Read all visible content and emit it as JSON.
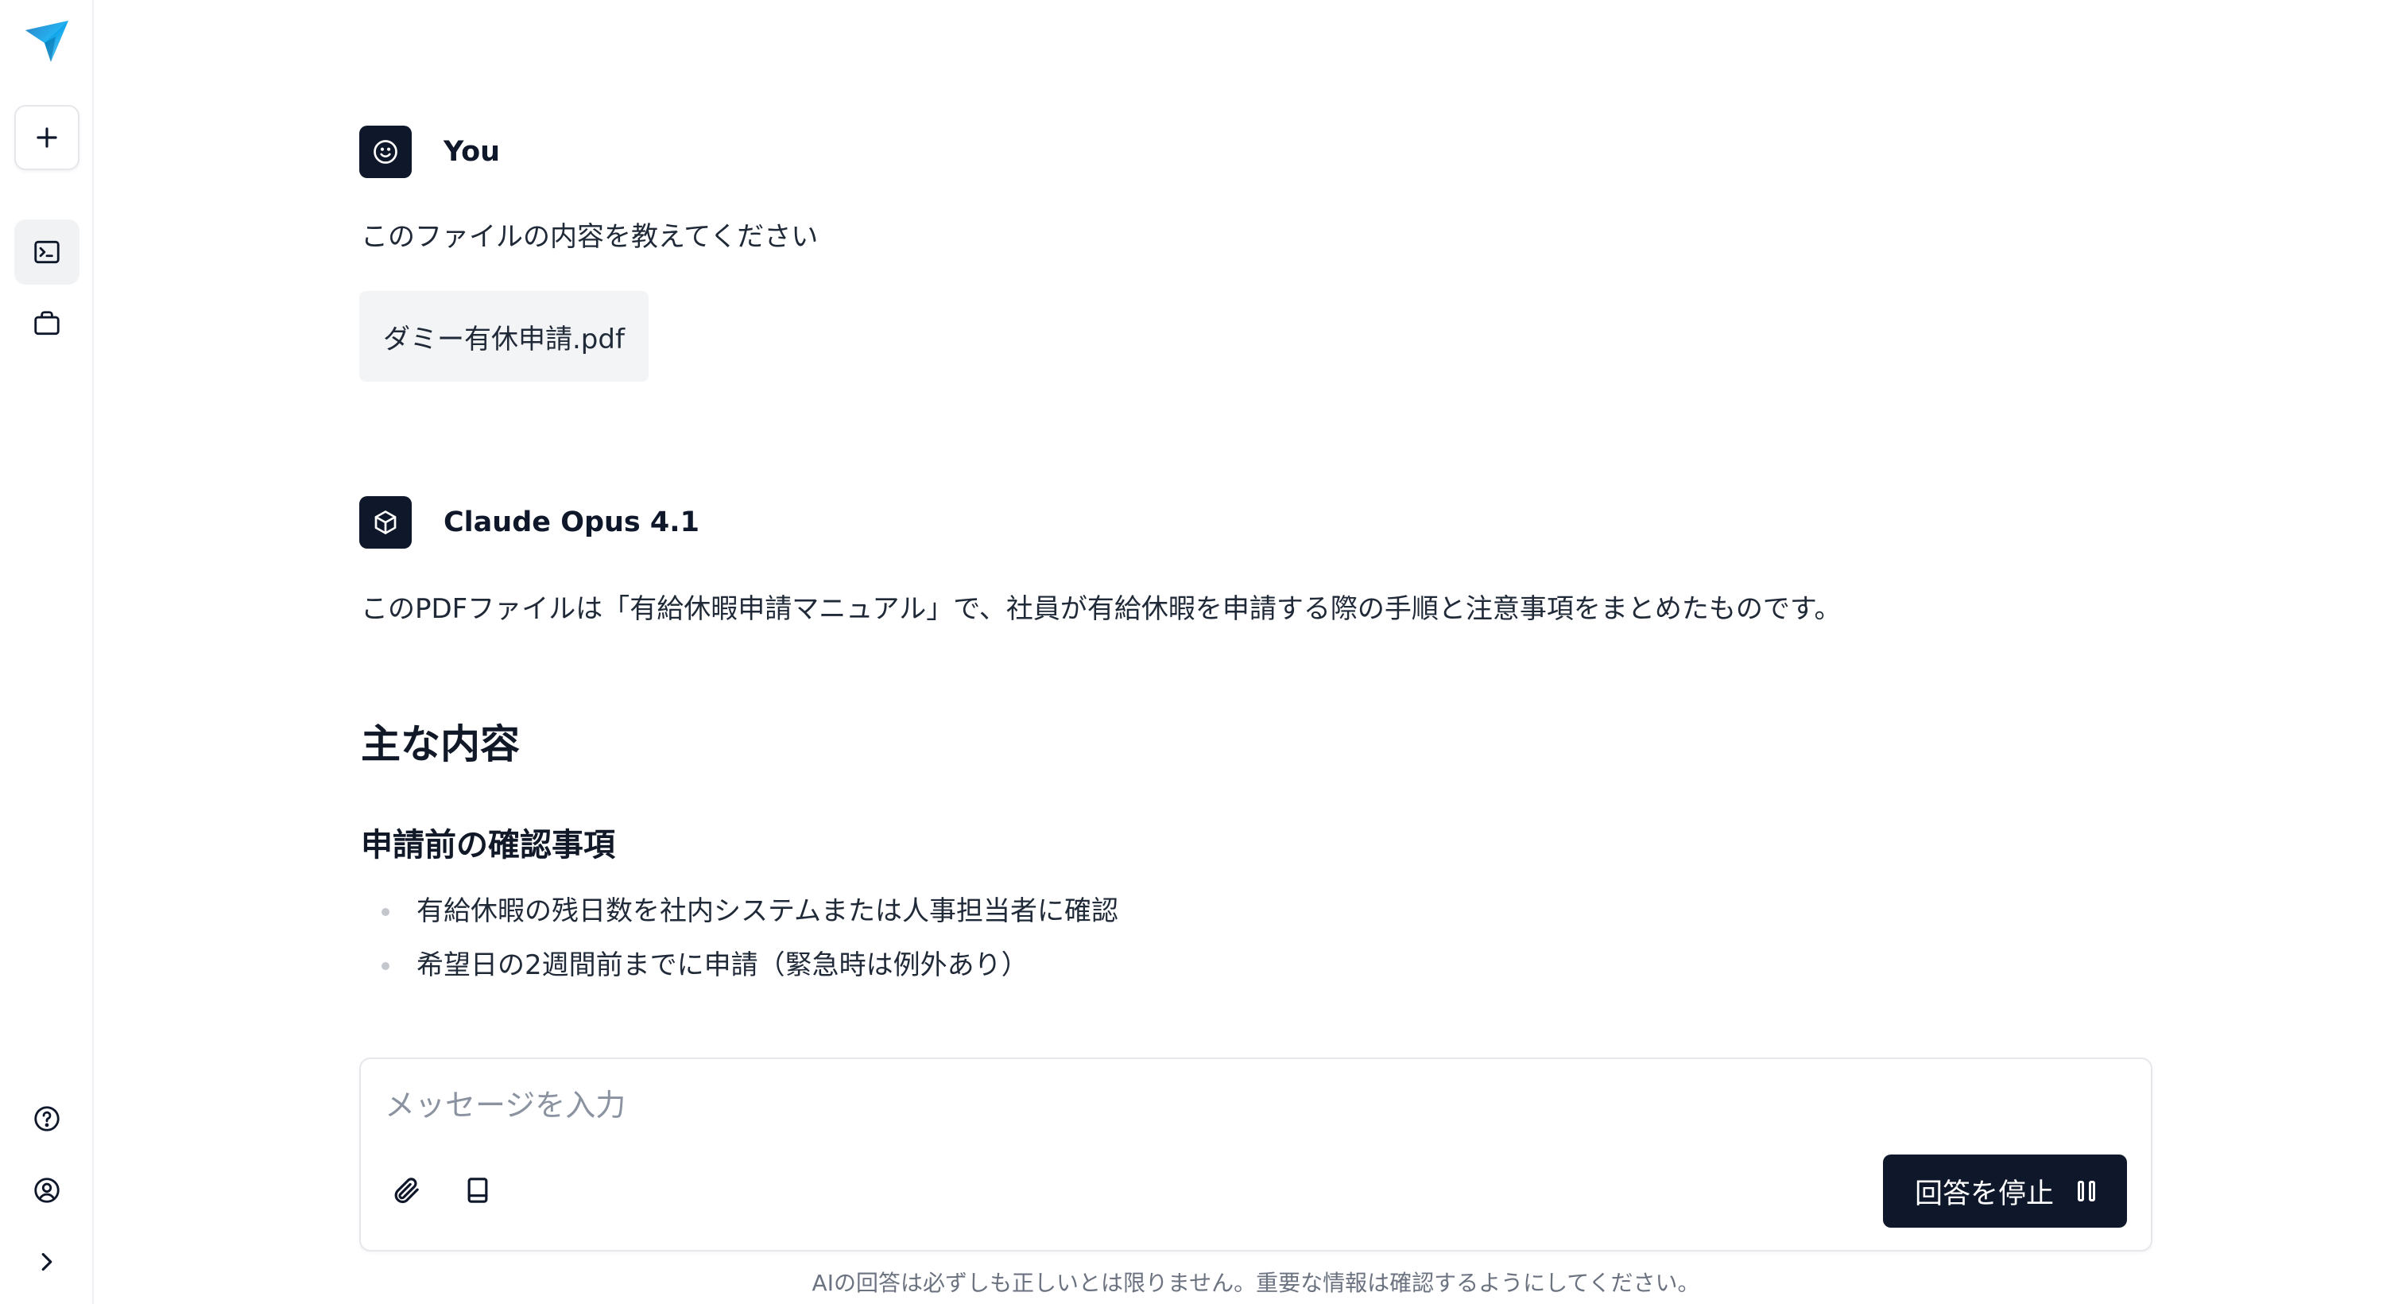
{
  "sidebar": {
    "logo_icon": "paper-plane-logo",
    "items": [
      {
        "name": "new-chat",
        "icon": "plus-icon"
      },
      {
        "name": "terminal",
        "icon": "terminal-icon",
        "active": true
      },
      {
        "name": "briefcase",
        "icon": "briefcase-icon"
      }
    ],
    "bottom_items": [
      {
        "name": "help",
        "icon": "help-circle-icon"
      },
      {
        "name": "account",
        "icon": "user-circle-icon"
      },
      {
        "name": "expand",
        "icon": "chevron-right-icon"
      }
    ]
  },
  "conversation": {
    "user_message": {
      "sender": "You",
      "avatar_icon": "smiley-icon",
      "text": "このファイルの内容を教えてください",
      "attachment": "ダミー有休申請.pdf"
    },
    "assistant_message": {
      "sender": "Claude Opus 4.1",
      "avatar_icon": "cube-icon",
      "intro": "このPDFファイルは「有給休暇申請マニュアル」で、社員が有給休暇を申請する際の手順と注意事項をまとめたものです。",
      "heading": "主な内容",
      "subheading": "申請前の確認事項",
      "bullets": [
        "有給休暇の残日数を社内システムまたは人事担当者に確認",
        "希望日の2週間前までに申請（緊急時は例外あり）"
      ]
    }
  },
  "composer": {
    "placeholder": "メッセージを入力",
    "value": "",
    "attach_icon": "paperclip-icon",
    "book_icon": "book-icon",
    "stop_label": "回答を停止",
    "stop_icon": "pause-icon"
  },
  "footer": {
    "disclaimer": "AIの回答は必ずしも正しいとは限りません。重要な情報は確認するようにしてください。"
  },
  "colors": {
    "primary": "#0f172a",
    "background": "#ffffff",
    "chip_background": "#f3f4f6",
    "logo_gradient": [
      "#0ea5e9",
      "#60a5fa"
    ]
  }
}
